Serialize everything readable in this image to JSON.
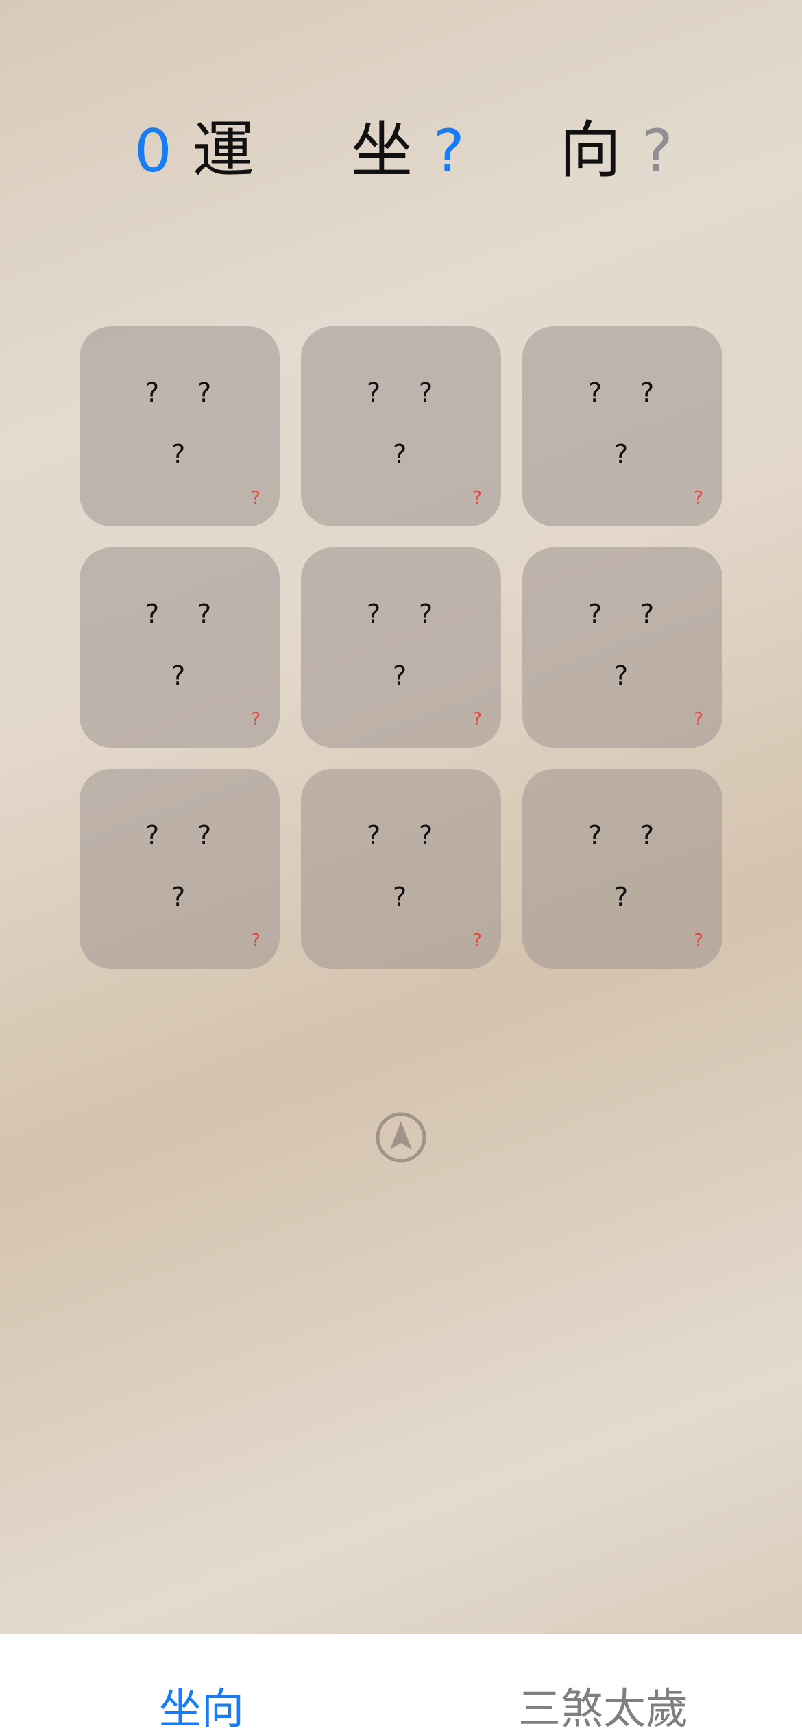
{
  "header": {
    "yun_number": "0",
    "yun_label": "運",
    "zuo_label": "坐",
    "zuo_value": "?",
    "xiang_label": "向",
    "xiang_value": "?"
  },
  "colors": {
    "accent_blue": "#1a7cf2",
    "muted_gray": "#8e8e93",
    "warning_red": "#e8453c",
    "tab_inactive": "#7f7f7f"
  },
  "grid": {
    "cells": [
      {
        "top_left": "?",
        "top_right": "?",
        "center": "?",
        "corner": "?"
      },
      {
        "top_left": "?",
        "top_right": "?",
        "center": "?",
        "corner": "?"
      },
      {
        "top_left": "?",
        "top_right": "?",
        "center": "?",
        "corner": "?"
      },
      {
        "top_left": "?",
        "top_right": "?",
        "center": "?",
        "corner": "?"
      },
      {
        "top_left": "?",
        "top_right": "?",
        "center": "?",
        "corner": "?"
      },
      {
        "top_left": "?",
        "top_right": "?",
        "center": "?",
        "corner": "?"
      },
      {
        "top_left": "?",
        "top_right": "?",
        "center": "?",
        "corner": "?"
      },
      {
        "top_left": "?",
        "top_right": "?",
        "center": "?",
        "corner": "?"
      },
      {
        "top_left": "?",
        "top_right": "?",
        "center": "?",
        "corner": "?"
      }
    ]
  },
  "compass_icon": "location-arrow-circle-icon",
  "tabs": [
    {
      "label": "坐向",
      "active": true
    },
    {
      "label": "三煞太歲",
      "active": false
    }
  ]
}
